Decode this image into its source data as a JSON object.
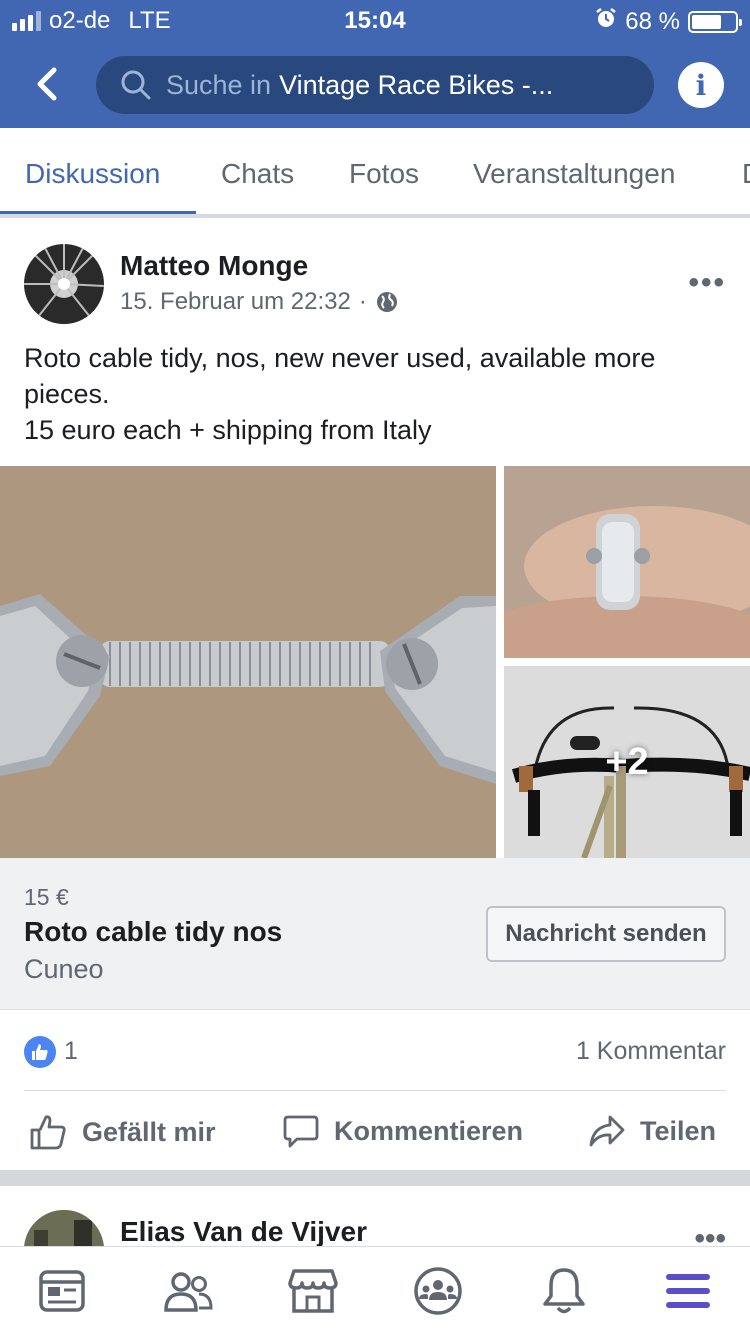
{
  "status_bar": {
    "carrier": "o2-de",
    "network": "LTE",
    "time": "15:04",
    "battery_percent": "68 %",
    "battery_level": 0.68
  },
  "nav": {
    "search_placeholder": "Suche in",
    "group_name": "Vintage Race Bikes -..."
  },
  "tabs": [
    {
      "label": "Diskussion",
      "active": true
    },
    {
      "label": "Chats",
      "active": false
    },
    {
      "label": "Fotos",
      "active": false
    },
    {
      "label": "Veranstaltungen",
      "active": false
    },
    {
      "label": "D",
      "active": false
    }
  ],
  "post": {
    "author": "Matteo Monge",
    "timestamp": "15. Februar um 22:32",
    "separator": "·",
    "text_line1": "Roto cable tidy, nos, new never used, available more pieces.",
    "text_line2": "15 euro each + shipping from Italy",
    "more_photos": "+2",
    "product": {
      "price": "15 €",
      "title": "Roto cable tidy nos",
      "location": "Cuneo",
      "button": "Nachricht senden"
    },
    "likes": "1",
    "comments": "1 Kommentar",
    "actions": {
      "like": "Gefällt mir",
      "comment": "Kommentieren",
      "share": "Teilen"
    }
  },
  "next_post": {
    "author": "Elias Van de Vijver"
  },
  "colors": {
    "brand": "#4267b2",
    "search_bg": "#29487d",
    "like_blue": "#4c85f2"
  }
}
